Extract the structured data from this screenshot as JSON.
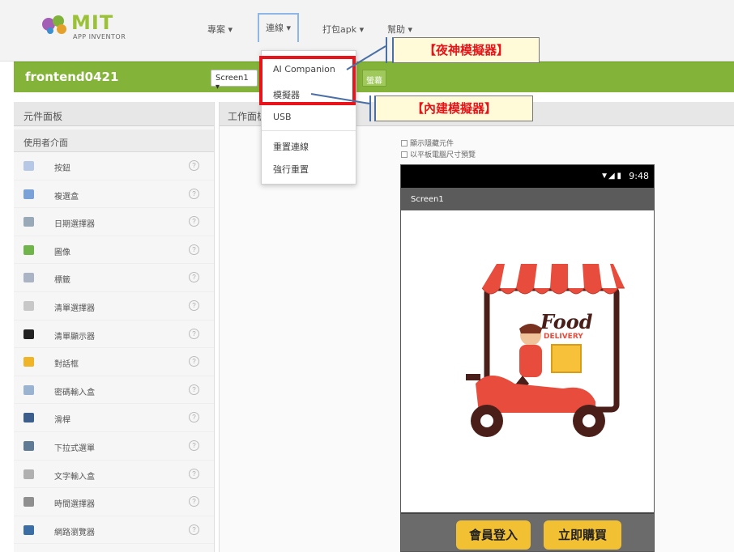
{
  "app": {
    "logo_text": "MIT",
    "logo_sub": "APP INVENTOR"
  },
  "top_menu": [
    {
      "label": "專案 ▾"
    },
    {
      "label": "連線 ▾"
    },
    {
      "label": "打包apk ▾"
    },
    {
      "label": "幫助 ▾"
    }
  ],
  "project": {
    "name": "frontend0421",
    "screen_selector": "Screen1 ▾",
    "button_label": "螢幕"
  },
  "connect_menu": {
    "items": [
      "AI Companion",
      "模擬器",
      "USB",
      "重置連線",
      "強行重置"
    ]
  },
  "callouts": {
    "nox": "【夜神模擬器】",
    "builtin": "【內建模擬器】"
  },
  "palette": {
    "title": "元件面板",
    "group": "使用者介面",
    "items": [
      {
        "label": "按鈕",
        "icon": "button-icon",
        "color": "#b7c8e6"
      },
      {
        "label": "複選盒",
        "icon": "checkbox-icon",
        "color": "#7aa1d8"
      },
      {
        "label": "日期選擇器",
        "icon": "calendar-icon",
        "color": "#9aa9b8"
      },
      {
        "label": "圖像",
        "icon": "image-icon",
        "color": "#6fb54b"
      },
      {
        "label": "標籤",
        "icon": "label-icon",
        "color": "#aab4c4"
      },
      {
        "label": "清單選擇器",
        "icon": "list-picker-icon",
        "color": "#c8c8c8"
      },
      {
        "label": "清單顯示器",
        "icon": "list-view-icon",
        "color": "#222222"
      },
      {
        "label": "對話框",
        "icon": "warning-icon",
        "color": "#f0b429"
      },
      {
        "label": "密碼輸入盒",
        "icon": "password-icon",
        "color": "#9ab3d1"
      },
      {
        "label": "滑桿",
        "icon": "slider-icon",
        "color": "#3c5e8c"
      },
      {
        "label": "下拉式選單",
        "icon": "spinner-icon",
        "color": "#5f7a94"
      },
      {
        "label": "文字輸入盒",
        "icon": "textbox-icon",
        "color": "#b0b0b0"
      },
      {
        "label": "時間選擇器",
        "icon": "clock-icon",
        "color": "#8f8f8f"
      },
      {
        "label": "網路瀏覽器",
        "icon": "web-icon",
        "color": "#3a6ea5"
      }
    ]
  },
  "viewer": {
    "title": "工作面板",
    "checkbox_hidden": "顯示隱藏元件",
    "checkbox_tablet": "以平板電腦尺寸預覽"
  },
  "phone": {
    "status_time": "9:48",
    "screen_title": "Screen1",
    "illustration_text_food": "Food",
    "illustration_text_delivery": "DELIVERY",
    "btn_login": "會員登入",
    "btn_buy": "立即購買"
  }
}
